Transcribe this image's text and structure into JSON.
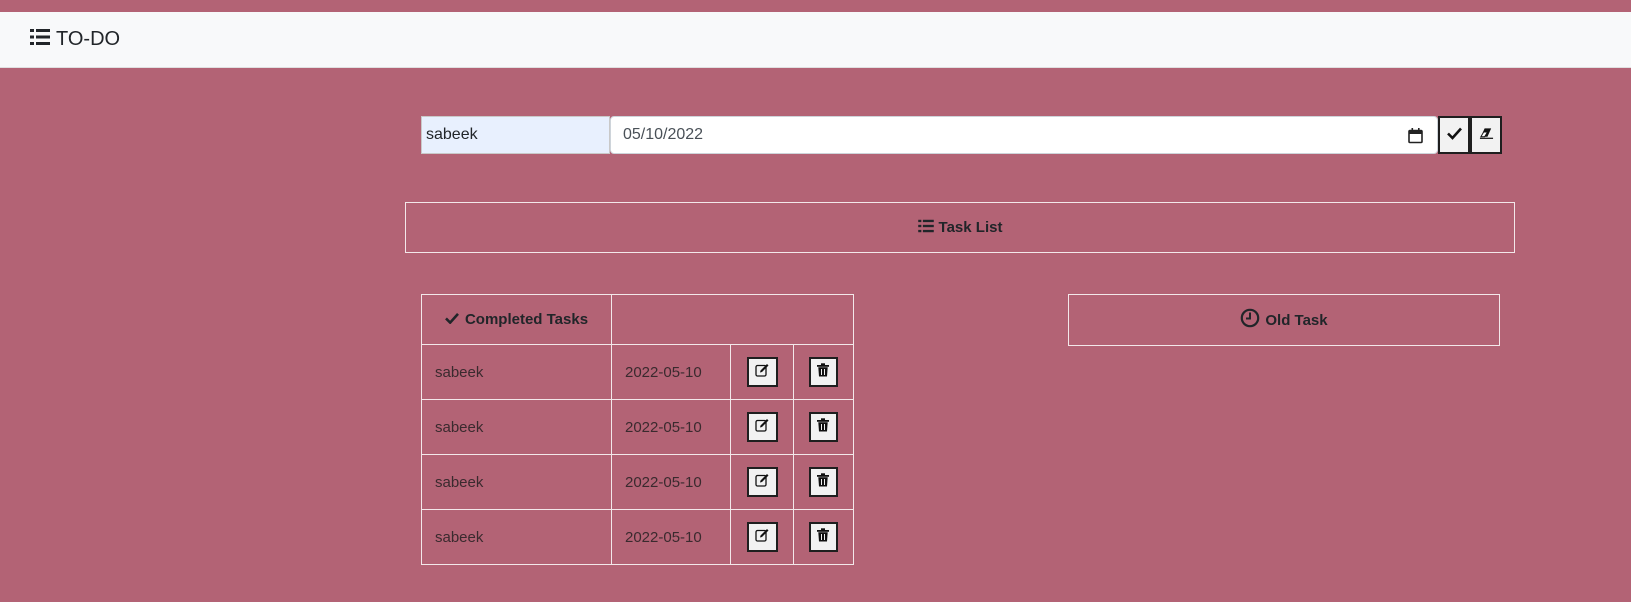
{
  "navbar": {
    "brand_label": "TO-DO",
    "brand_icon": "list-icon"
  },
  "form": {
    "name_value": "sabeek",
    "date_value": "05/10/2022",
    "submit_icon": "check-icon",
    "clear_icon": "eraser-icon"
  },
  "task_list": {
    "label": "Task List",
    "icon": "list-icon"
  },
  "completed": {
    "header_label": "Completed Tasks",
    "header_icon": "check-icon",
    "rows": [
      {
        "name": "sabeek",
        "date": "2022-05-10"
      },
      {
        "name": "sabeek",
        "date": "2022-05-10"
      },
      {
        "name": "sabeek",
        "date": "2022-05-10"
      },
      {
        "name": "sabeek",
        "date": "2022-05-10"
      }
    ]
  },
  "old_task": {
    "label": "Old Task",
    "icon": "clock-icon"
  },
  "colors": {
    "background": "#b36375",
    "navbar": "#f8f9fa",
    "border": "#f3e8ea"
  }
}
